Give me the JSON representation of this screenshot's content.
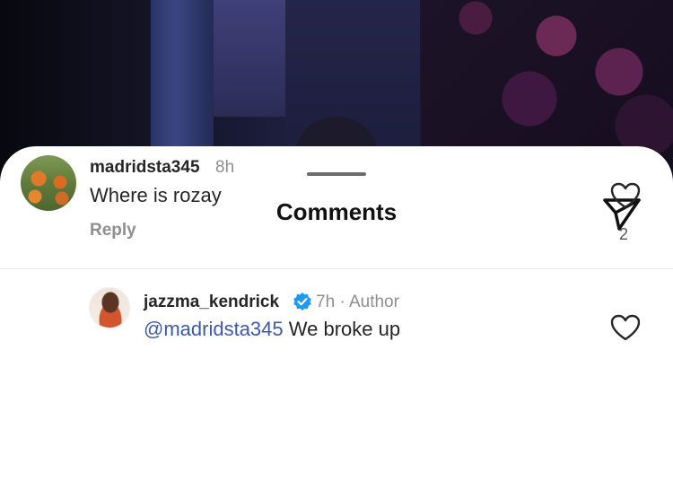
{
  "header": {
    "title": "Comments"
  },
  "icons": {
    "share": "paper-plane-icon",
    "like": "heart-icon",
    "verified": "verified-badge-icon"
  },
  "colors": {
    "mention": "#3d5aa8",
    "verified": "#1d9bf0",
    "secondary_text": "#8e8e8e"
  },
  "comments": [
    {
      "username": "madridsta345",
      "time": "8h",
      "text": "Where is rozay",
      "reply_label": "Reply",
      "like_count": "2"
    },
    {
      "username": "jazzma_kendrick",
      "verified": true,
      "time": "7h · Author",
      "mention": "@madridsta345",
      "text": " We broke up"
    }
  ]
}
